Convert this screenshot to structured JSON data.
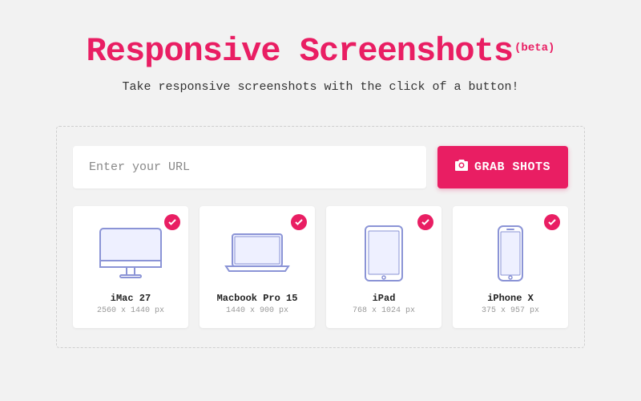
{
  "title": "Responsive Screenshots",
  "badge": "(beta)",
  "subtitle": "Take responsive screenshots with the click of a button!",
  "input": {
    "placeholder": "Enter your URL"
  },
  "button": {
    "label": "GRAB SHOTS"
  },
  "devices": [
    {
      "name": "iMac 27",
      "resolution": "2560 x 1440 px"
    },
    {
      "name": "Macbook Pro 15",
      "resolution": "1440 x 900 px"
    },
    {
      "name": "iPad",
      "resolution": "768 x 1024 px"
    },
    {
      "name": "iPhone X",
      "resolution": "375 x 957 px"
    }
  ],
  "colors": {
    "accent": "#e91e63"
  }
}
